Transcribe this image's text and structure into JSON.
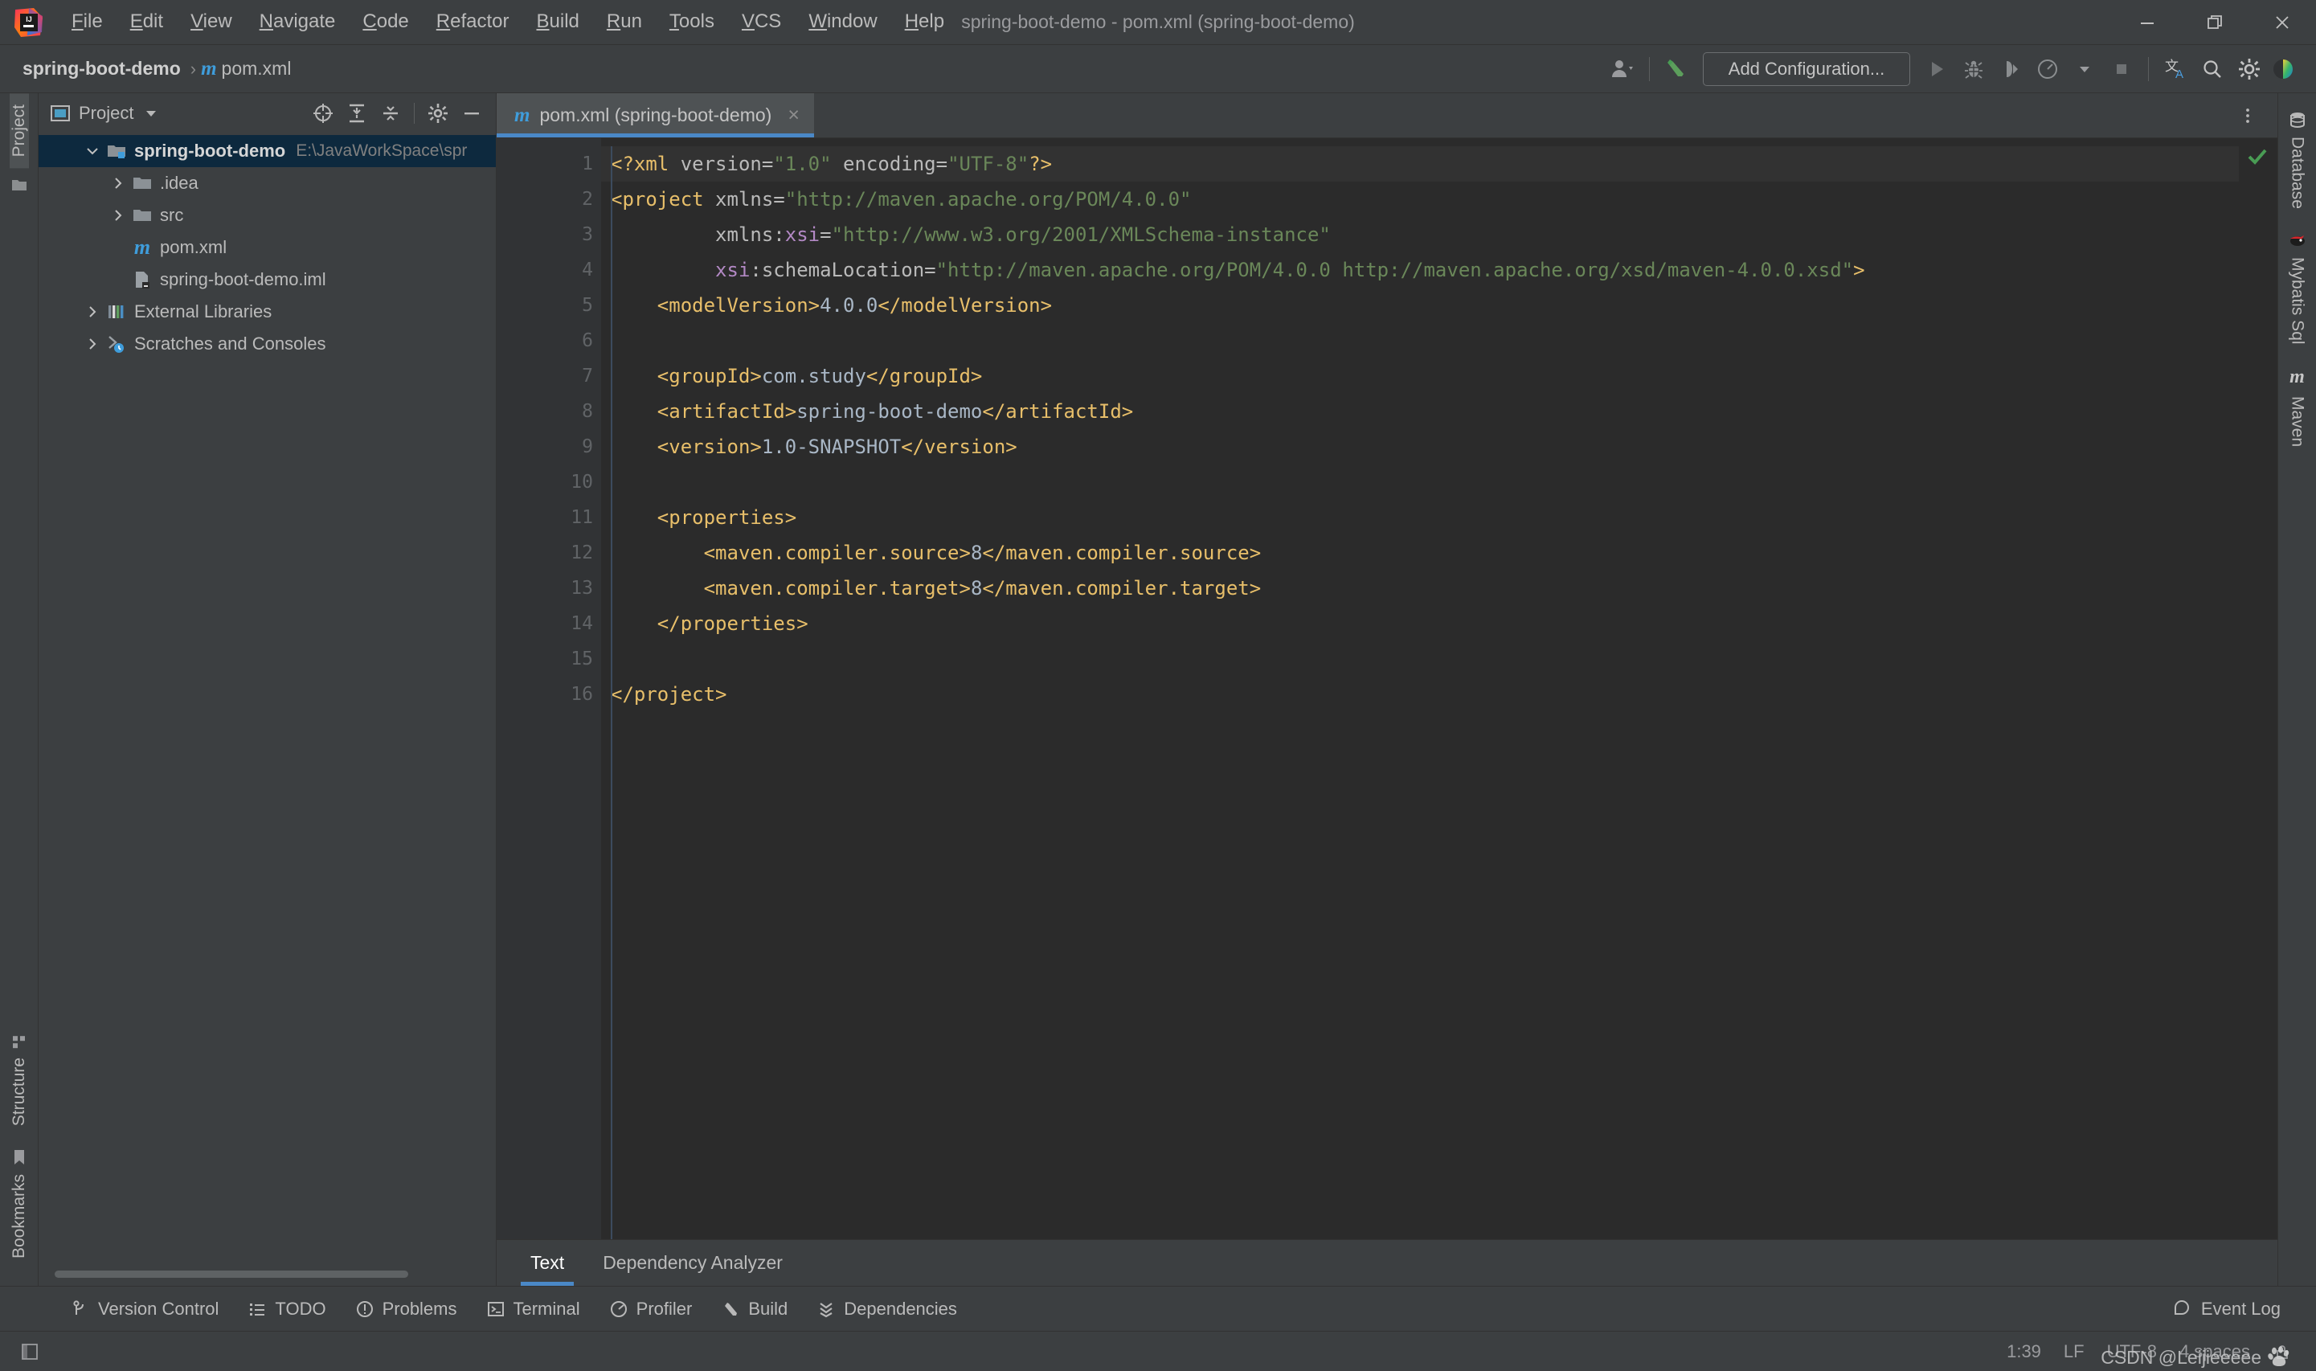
{
  "window": {
    "title": "spring-boot-demo - pom.xml (spring-boot-demo)",
    "minimize_label": "Minimize",
    "maximize_label": "Restore",
    "close_label": "Close"
  },
  "menu": [
    {
      "label": "File",
      "mnemonic": "F"
    },
    {
      "label": "Edit",
      "mnemonic": "E"
    },
    {
      "label": "View",
      "mnemonic": "V"
    },
    {
      "label": "Navigate",
      "mnemonic": "N"
    },
    {
      "label": "Code",
      "mnemonic": "C"
    },
    {
      "label": "Refactor",
      "mnemonic": "R"
    },
    {
      "label": "Build",
      "mnemonic": "B"
    },
    {
      "label": "Run",
      "mnemonic": "R"
    },
    {
      "label": "Tools",
      "mnemonic": "T"
    },
    {
      "label": "VCS",
      "mnemonic": "V"
    },
    {
      "label": "Window",
      "mnemonic": "W"
    },
    {
      "label": "Help",
      "mnemonic": "H"
    }
  ],
  "breadcrumb": {
    "project": "spring-boot-demo",
    "separator": "›",
    "file": "pom.xml",
    "file_icon": "maven-m-icon"
  },
  "toolbar": {
    "run_configuration": "Add Configuration...",
    "buttons": [
      {
        "name": "user-avatar-dropdown",
        "icon": "user-icon"
      },
      {
        "name": "build-hammer",
        "icon": "hammer-icon"
      },
      {
        "name": "run",
        "icon": "play-icon"
      },
      {
        "name": "debug",
        "icon": "bug-icon"
      },
      {
        "name": "run-with-coverage",
        "icon": "coverage-icon"
      },
      {
        "name": "profile-dropdown",
        "icon": "profile-icon"
      },
      {
        "name": "stop",
        "icon": "stop-icon"
      },
      {
        "name": "translate",
        "icon": "translate-icon"
      },
      {
        "name": "search-everywhere",
        "icon": "search-icon"
      },
      {
        "name": "settings",
        "icon": "gear-icon"
      },
      {
        "name": "theme",
        "icon": "theme-icon"
      }
    ]
  },
  "project_panel": {
    "title": "Project",
    "header_buttons": [
      {
        "name": "select-opened-file",
        "icon": "target-icon"
      },
      {
        "name": "expand-all",
        "icon": "expand-all-icon"
      },
      {
        "name": "collapse-all",
        "icon": "collapse-all-icon"
      },
      {
        "name": "settings",
        "icon": "gear-icon"
      },
      {
        "name": "hide",
        "icon": "minus-icon"
      }
    ],
    "tree": [
      {
        "label": "spring-boot-demo",
        "path": "E:\\JavaWorkSpace\\spr",
        "indent": 0,
        "arrow": "down",
        "icon": "module-folder-icon",
        "selected": true,
        "bold": true
      },
      {
        "label": ".idea",
        "path": "",
        "indent": 1,
        "arrow": "right",
        "icon": "folder-icon",
        "selected": false,
        "bold": false
      },
      {
        "label": "src",
        "path": "",
        "indent": 1,
        "arrow": "right",
        "icon": "folder-icon",
        "selected": false,
        "bold": false
      },
      {
        "label": "pom.xml",
        "path": "",
        "indent": 1,
        "arrow": "none",
        "icon": "maven-m-icon",
        "selected": false,
        "bold": false
      },
      {
        "label": "spring-boot-demo.iml",
        "path": "",
        "indent": 1,
        "arrow": "none",
        "icon": "iml-file-icon",
        "selected": false,
        "bold": false
      },
      {
        "label": "External Libraries",
        "path": "",
        "indent": 0,
        "arrow": "right",
        "icon": "libraries-icon",
        "selected": false,
        "bold": false
      },
      {
        "label": "Scratches and Consoles",
        "path": "",
        "indent": 0,
        "arrow": "right",
        "icon": "scratches-icon",
        "selected": false,
        "bold": false
      }
    ]
  },
  "left_strip": {
    "top": [
      {
        "label": "Project",
        "selected": true,
        "icon": "project-icon"
      }
    ],
    "top_extra": [
      {
        "label": "",
        "icon": "folder-icon"
      }
    ],
    "bottom": [
      {
        "label": "Structure",
        "icon": "structure-icon"
      },
      {
        "label": "Bookmarks",
        "icon": "bookmark-icon"
      }
    ]
  },
  "right_strip": [
    {
      "label": "Database",
      "icon": "database-icon"
    },
    {
      "label": "Mybatis Sql",
      "icon": "mybatis-icon"
    },
    {
      "label": "Maven",
      "icon": "maven-m-icon"
    }
  ],
  "editor": {
    "tab": {
      "label": "pom.xml (spring-boot-demo)",
      "icon": "maven-m-icon",
      "close": "×",
      "selected": true
    },
    "options_icon": "more-vertical-icon",
    "inspection_status": "ok",
    "lines": [
      {
        "n": 1,
        "fold": "none",
        "tokens": [
          {
            "t": "pi",
            "s": "<?xml "
          },
          {
            "t": "at",
            "s": "version"
          },
          {
            "t": "at",
            "s": "="
          },
          {
            "t": "vl",
            "s": "\"1.0\""
          },
          {
            "t": "at",
            "s": " "
          },
          {
            "t": "at",
            "s": "encoding"
          },
          {
            "t": "at",
            "s": "="
          },
          {
            "t": "vl",
            "s": "\"UTF-8\""
          },
          {
            "t": "pi",
            "s": "?>"
          }
        ]
      },
      {
        "n": 2,
        "fold": "start",
        "tokens": [
          {
            "t": "tg",
            "s": "<project "
          },
          {
            "t": "at",
            "s": "xmlns"
          },
          {
            "t": "at",
            "s": "="
          },
          {
            "t": "vl",
            "s": "\"http://maven.apache.org/POM/4.0.0\""
          }
        ]
      },
      {
        "n": 3,
        "fold": "bar",
        "tokens": [
          {
            "t": "at",
            "s": "         xmlns:"
          },
          {
            "t": "ns",
            "s": "xsi"
          },
          {
            "t": "at",
            "s": "="
          },
          {
            "t": "vl",
            "s": "\"http://www.w3.org/2001/XMLSchema-instance\""
          }
        ]
      },
      {
        "n": 4,
        "fold": "bar",
        "tokens": [
          {
            "t": "ns",
            "s": "         xsi"
          },
          {
            "t": "at",
            "s": ":schemaLocation"
          },
          {
            "t": "at",
            "s": "="
          },
          {
            "t": "vl",
            "s": "\"http://maven.apache.org/POM/4.0.0 http://maven.apache.org/xsd/maven-4.0.0.xsd\""
          },
          {
            "t": "tg",
            "s": ">"
          }
        ]
      },
      {
        "n": 5,
        "fold": "bar",
        "tokens": [
          {
            "t": "tg",
            "s": "    <modelVersion>"
          },
          {
            "t": "tx",
            "s": "4.0.0"
          },
          {
            "t": "tg",
            "s": "</modelVersion>"
          }
        ]
      },
      {
        "n": 6,
        "fold": "bar",
        "tokens": []
      },
      {
        "n": 7,
        "fold": "bar",
        "tokens": [
          {
            "t": "tg",
            "s": "    <groupId>"
          },
          {
            "t": "tx",
            "s": "com.study"
          },
          {
            "t": "tg",
            "s": "</groupId>"
          }
        ]
      },
      {
        "n": 8,
        "fold": "bar",
        "tokens": [
          {
            "t": "tg",
            "s": "    <artifactId>"
          },
          {
            "t": "tx",
            "s": "spring-boot-demo"
          },
          {
            "t": "tg",
            "s": "</artifactId>"
          }
        ]
      },
      {
        "n": 9,
        "fold": "bar",
        "tokens": [
          {
            "t": "tg",
            "s": "    <version>"
          },
          {
            "t": "tx",
            "s": "1.0-SNAPSHOT"
          },
          {
            "t": "tg",
            "s": "</version>"
          }
        ]
      },
      {
        "n": 10,
        "fold": "bar",
        "tokens": []
      },
      {
        "n": 11,
        "fold": "start",
        "tokens": [
          {
            "t": "tg",
            "s": "    <properties>"
          }
        ]
      },
      {
        "n": 12,
        "fold": "bar",
        "tokens": [
          {
            "t": "tg",
            "s": "        <maven.compiler.source>"
          },
          {
            "t": "tx",
            "s": "8"
          },
          {
            "t": "tg",
            "s": "</maven.compiler.source>"
          }
        ]
      },
      {
        "n": 13,
        "fold": "bar",
        "tokens": [
          {
            "t": "tg",
            "s": "        <maven.compiler.target>"
          },
          {
            "t": "tx",
            "s": "8"
          },
          {
            "t": "tg",
            "s": "</maven.compiler.target>"
          }
        ]
      },
      {
        "n": 14,
        "fold": "end",
        "tokens": [
          {
            "t": "tg",
            "s": "    </properties>"
          }
        ]
      },
      {
        "n": 15,
        "fold": "bar",
        "tokens": []
      },
      {
        "n": 16,
        "fold": "end",
        "tokens": [
          {
            "t": "tg",
            "s": "</project>"
          }
        ]
      }
    ],
    "subtabs": [
      {
        "label": "Text",
        "selected": true
      },
      {
        "label": "Dependency Analyzer",
        "selected": false
      }
    ]
  },
  "bottom_bar": [
    {
      "label": "Version Control",
      "icon": "branch-icon"
    },
    {
      "label": "TODO",
      "icon": "todo-icon"
    },
    {
      "label": "Problems",
      "icon": "problems-icon"
    },
    {
      "label": "Terminal",
      "icon": "terminal-icon"
    },
    {
      "label": "Profiler",
      "icon": "profiler-icon"
    },
    {
      "label": "Build",
      "icon": "build-icon"
    },
    {
      "label": "Dependencies",
      "icon": "dependencies-icon"
    }
  ],
  "event_log": {
    "label": "Event Log",
    "icon": "balloon-icon"
  },
  "status_bar": {
    "caret": "1:39",
    "line_separator": "LF",
    "encoding": "UTF-8",
    "indent": "4 spaces",
    "watermark": "CSDN @Leijieeeee",
    "toggle_icon": "sidebar-toggle-icon",
    "lock_icon": "lock-icon"
  },
  "colors": {
    "accent": "#4a88c7",
    "selection": "#0d293e",
    "editor_bg": "#2b2b2b",
    "panel_bg": "#3c3f41",
    "gutter_bg": "#313335",
    "tag": "#e8bf6a",
    "value": "#6a8759",
    "text": "#a9b7c6",
    "ns": "#b389c5",
    "ok_green": "#499c54"
  }
}
